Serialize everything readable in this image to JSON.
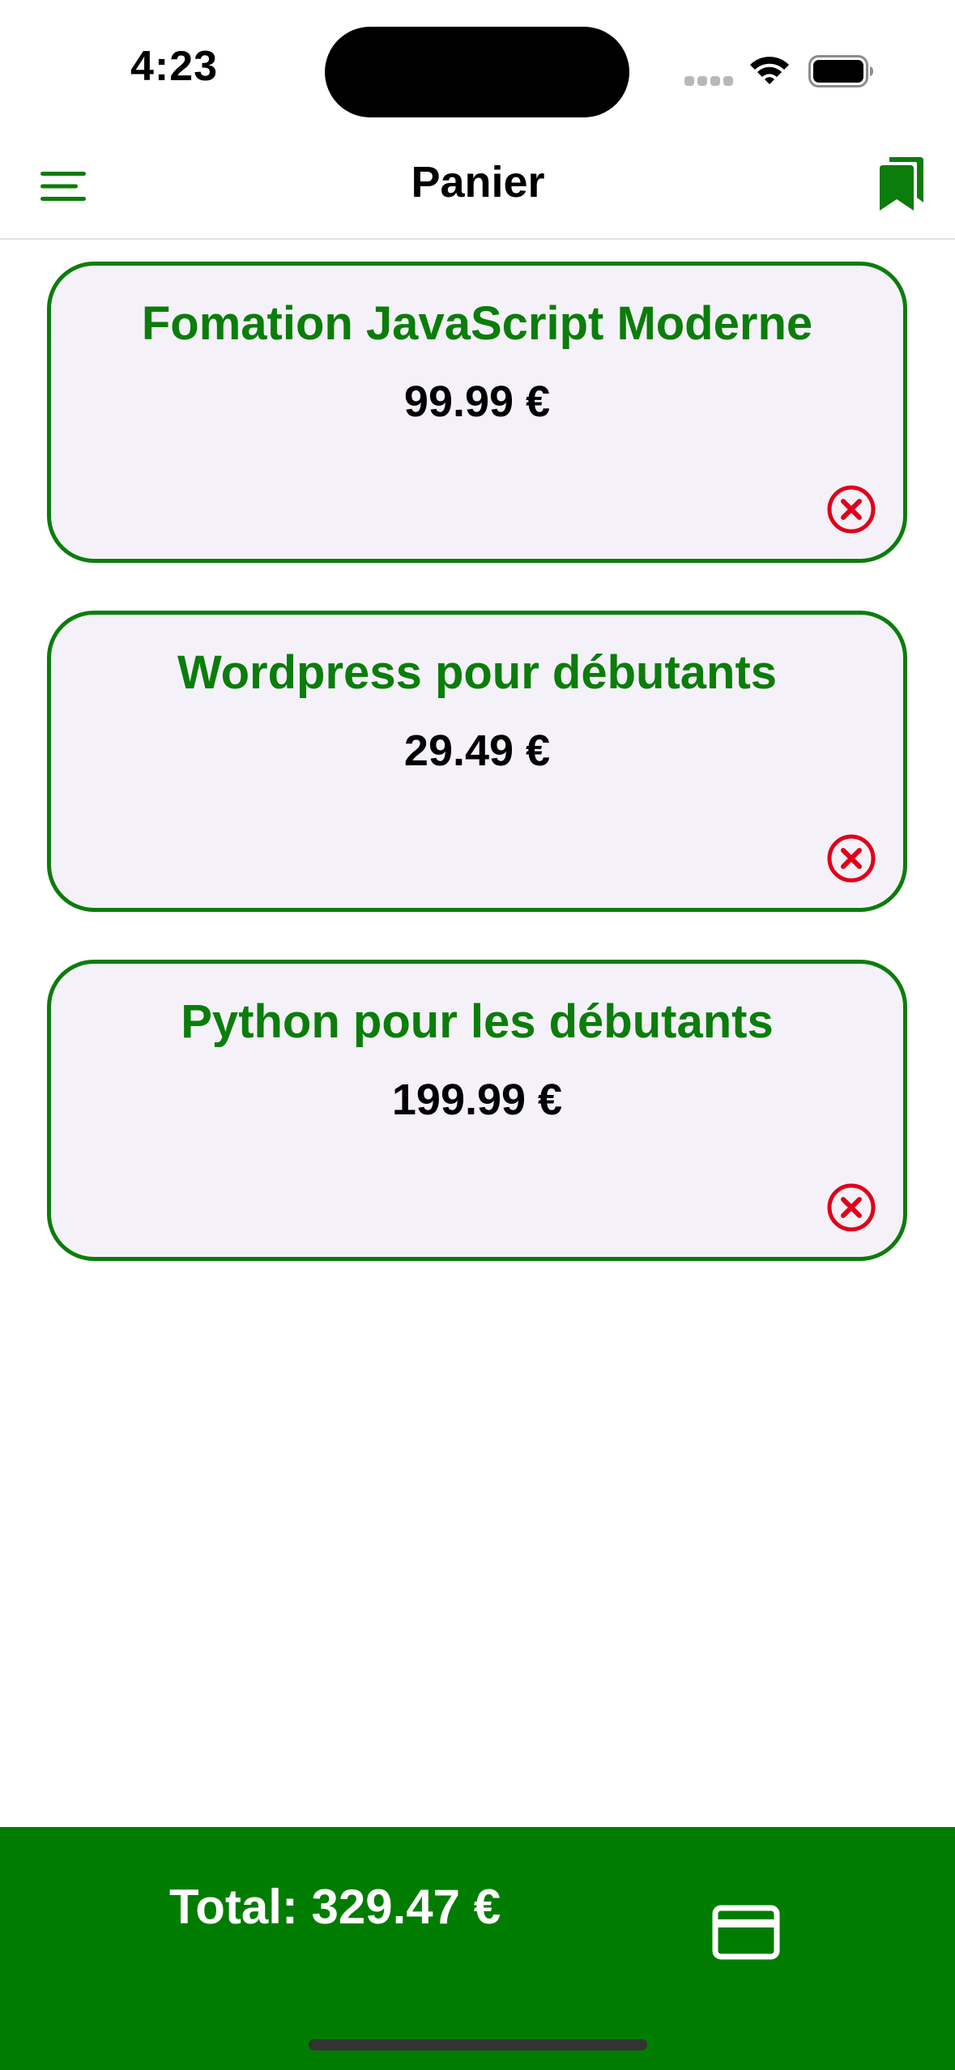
{
  "status_bar": {
    "time": "4:23"
  },
  "nav": {
    "title": "Panier",
    "menu_icon": "menu-icon",
    "bookmark_icon": "bookmarks-icon"
  },
  "cart": {
    "items": [
      {
        "title": "Fomation JavaScript Moderne",
        "price": "99.99 €"
      },
      {
        "title": "Wordpress pour débutants",
        "price": "29.49 €"
      },
      {
        "title": "Python pour les débutants",
        "price": "199.99 €"
      }
    ],
    "remove_icon": "remove-circle-icon"
  },
  "footer": {
    "total": "Total: 329.47 €",
    "pay_icon": "credit-card-icon"
  },
  "colors": {
    "primary_green": "#007d00",
    "card_background": "#f5f1f8",
    "remove_red": "#e0001a"
  }
}
